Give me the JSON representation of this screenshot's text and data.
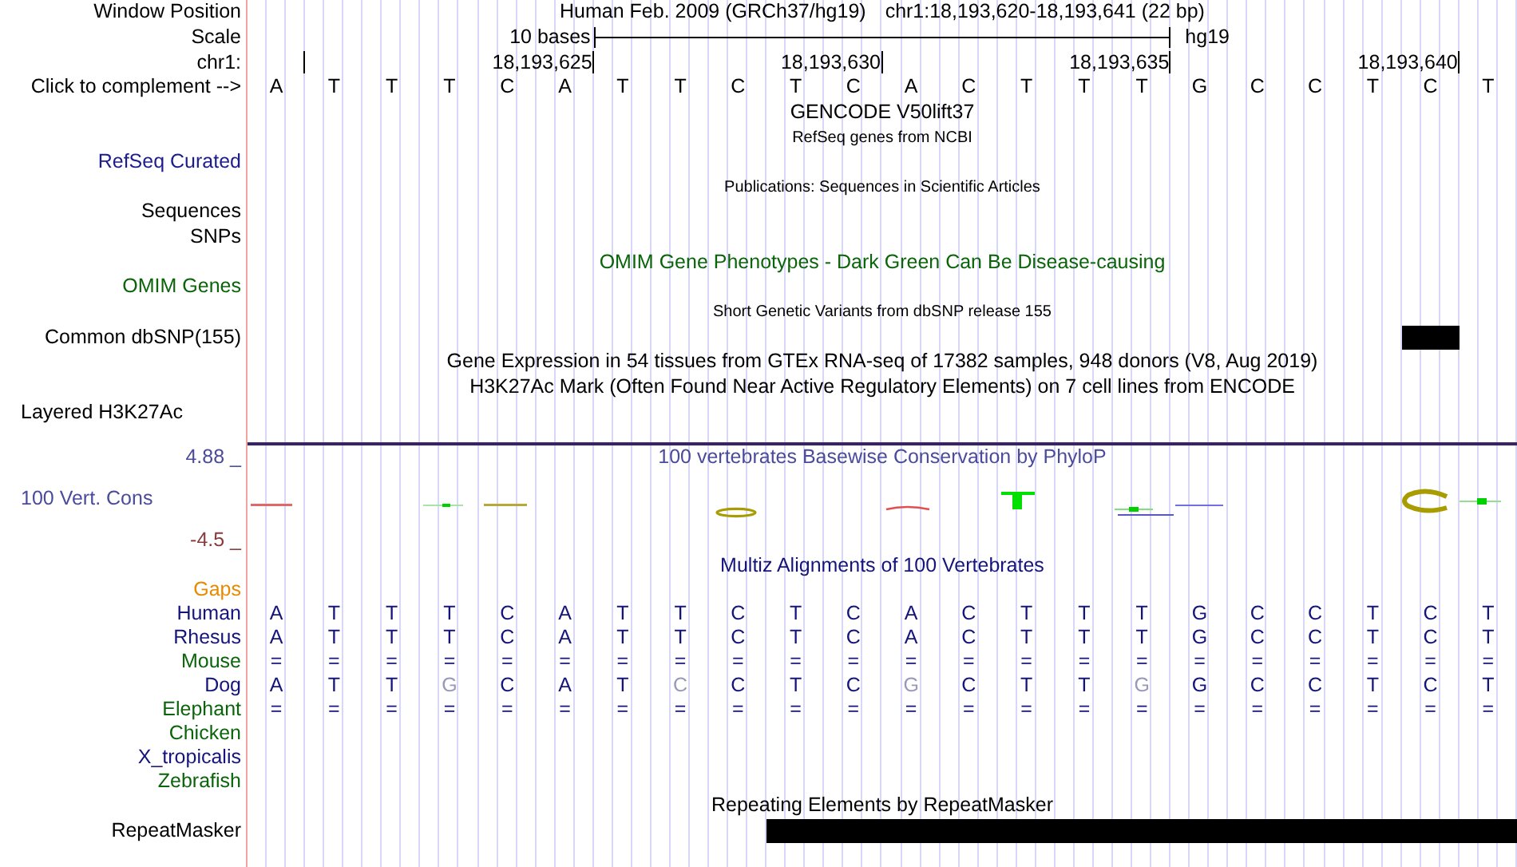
{
  "ruler": {
    "window_position_label": "Window Position",
    "assembly": "Human Feb. 2009 (GRCh37/hg19)",
    "position": "chr1:18,193,620-18,193,641 (22 bp)",
    "scale_label": "Scale",
    "scale_text": "10 bases",
    "scale_db": "hg19",
    "chrom_label": "chr1:",
    "tick_labels": [
      "18,193,625",
      "18,193,630",
      "18,193,635",
      "18,193,640"
    ],
    "complement_label": "Click to complement -->",
    "bases": [
      "A",
      "T",
      "T",
      "T",
      "C",
      "A",
      "T",
      "T",
      "C",
      "T",
      "C",
      "A",
      "C",
      "T",
      "T",
      "T",
      "G",
      "C",
      "C",
      "T",
      "C",
      "T"
    ]
  },
  "tracks": [
    {
      "kind": "plain",
      "title": {
        "text": "GENCODE V50lift37",
        "color": "#000000",
        "kind": "normal"
      }
    },
    {
      "kind": "plain",
      "title": {
        "text": "RefSeq genes from NCBI",
        "color": "#000000",
        "kind": "small"
      },
      "labels": [
        {
          "text": "RefSeq Curated",
          "color": "#1c1c8c"
        }
      ]
    },
    {
      "kind": "plain",
      "title": {
        "text": "Publications: Sequences in Scientific Articles",
        "color": "#000000",
        "kind": "small"
      },
      "labels": [
        {
          "text": "Sequences",
          "color": "#000000"
        },
        {
          "text": "SNPs",
          "color": "#000000"
        }
      ]
    },
    {
      "kind": "plain",
      "title": {
        "text": "OMIM Gene Phenotypes - Dark Green Can Be Disease-causing",
        "color": "#0a640a",
        "kind": "normal"
      },
      "labels": [
        {
          "text": "OMIM Genes",
          "color": "#0a640a"
        }
      ]
    },
    {
      "kind": "plain",
      "title": {
        "text": "Short Genetic Variants from dbSNP release 155",
        "color": "#000000",
        "kind": "small"
      },
      "labels": [
        {
          "text": "Common dbSNP(155)",
          "color": "#000000",
          "covered": [
            false,
            false,
            false,
            false,
            false,
            false,
            false,
            false,
            false,
            false,
            false,
            false,
            false,
            false,
            false,
            false,
            false,
            false,
            false,
            false,
            true,
            false
          ]
        }
      ]
    },
    {
      "kind": "plain",
      "title": {
        "text": "Gene Expression in 54 tissues from GTEx RNA-seq of 17382 samples, 948 donors (V8, Aug 2019)",
        "color": "#000000",
        "kind": "normal"
      }
    },
    {
      "kind": "layered",
      "title": {
        "text": "H3K27Ac Mark (Often Found Near Active Regulatory Elements) on 7 cell lines from ENCODE",
        "color": "#000000",
        "kind": "normal"
      },
      "labels": [
        {
          "text": "Layered H3K27Ac",
          "color": "#000000"
        }
      ]
    }
  ],
  "conservation": {
    "title": "100 vertebrates Basewise Conservation by PhyloP",
    "upper": "4.88 _",
    "label": "100 Vert. Cons",
    "lower": "-4.5 _"
  },
  "alignment": {
    "title": "Multiz Alignments of 100 Vertebrates",
    "rows": [
      {
        "name": "Gaps",
        "color": "#e88a00"
      },
      {
        "name": "Human",
        "color": "#14147c",
        "bases": [
          "A",
          "T",
          "T",
          "T",
          "C",
          "A",
          "T",
          "T",
          "C",
          "T",
          "C",
          "A",
          "C",
          "T",
          "T",
          "T",
          "G",
          "C",
          "C",
          "T",
          "C",
          "T"
        ],
        "mismatch": [
          false,
          false,
          false,
          false,
          false,
          false,
          false,
          false,
          false,
          false,
          false,
          false,
          false,
          false,
          false,
          false,
          false,
          false,
          false,
          false,
          false,
          false
        ]
      },
      {
        "name": "Rhesus",
        "color": "#14147c",
        "bases": [
          "A",
          "T",
          "T",
          "T",
          "C",
          "A",
          "T",
          "T",
          "C",
          "T",
          "C",
          "A",
          "C",
          "T",
          "T",
          "T",
          "G",
          "C",
          "C",
          "T",
          "C",
          "T"
        ],
        "mismatch": [
          false,
          false,
          false,
          false,
          false,
          false,
          false,
          false,
          false,
          false,
          false,
          false,
          false,
          false,
          false,
          false,
          false,
          false,
          false,
          false,
          false,
          false
        ]
      },
      {
        "name": "Mouse",
        "color": "#0a640a",
        "bases": [
          "=",
          "=",
          "=",
          "=",
          "=",
          "=",
          "=",
          "=",
          "=",
          "=",
          "=",
          "=",
          "=",
          "=",
          "=",
          "=",
          "=",
          "=",
          "=",
          "=",
          "=",
          "="
        ],
        "mismatch": [
          false,
          false,
          false,
          false,
          false,
          false,
          false,
          false,
          false,
          false,
          false,
          false,
          false,
          false,
          false,
          false,
          false,
          false,
          false,
          false,
          false,
          false
        ]
      },
      {
        "name": "Dog",
        "color": "#14147c",
        "bases": [
          "A",
          "T",
          "T",
          "G",
          "C",
          "A",
          "T",
          "C",
          "C",
          "T",
          "C",
          "G",
          "C",
          "T",
          "T",
          "G",
          "G",
          "C",
          "C",
          "T",
          "C",
          "T"
        ],
        "mismatch": [
          false,
          false,
          false,
          true,
          false,
          false,
          false,
          true,
          false,
          false,
          false,
          true,
          false,
          false,
          false,
          true,
          false,
          false,
          false,
          false,
          false,
          false
        ]
      },
      {
        "name": "Elephant",
        "color": "#0a640a",
        "bases": [
          "=",
          "=",
          "=",
          "=",
          "=",
          "=",
          "=",
          "=",
          "=",
          "=",
          "=",
          "=",
          "=",
          "=",
          "=",
          "=",
          "=",
          "=",
          "=",
          "=",
          "=",
          "="
        ],
        "mismatch": [
          false,
          false,
          false,
          false,
          false,
          false,
          false,
          false,
          false,
          false,
          false,
          false,
          false,
          false,
          false,
          false,
          false,
          false,
          false,
          false,
          false,
          false
        ]
      },
      {
        "name": "Chicken",
        "color": "#0a640a"
      },
      {
        "name": "X_tropicalis",
        "color": "#14147c"
      },
      {
        "name": "Zebrafish",
        "color": "#0a640a"
      }
    ]
  },
  "repeatmasker": {
    "title": "Repeating Elements by RepeatMasker",
    "label": "RepeatMasker",
    "covered": [
      false,
      false,
      false,
      false,
      false,
      false,
      false,
      false,
      false,
      true,
      true,
      true,
      true,
      true,
      true,
      true,
      true,
      true,
      true,
      true,
      true,
      true
    ]
  }
}
